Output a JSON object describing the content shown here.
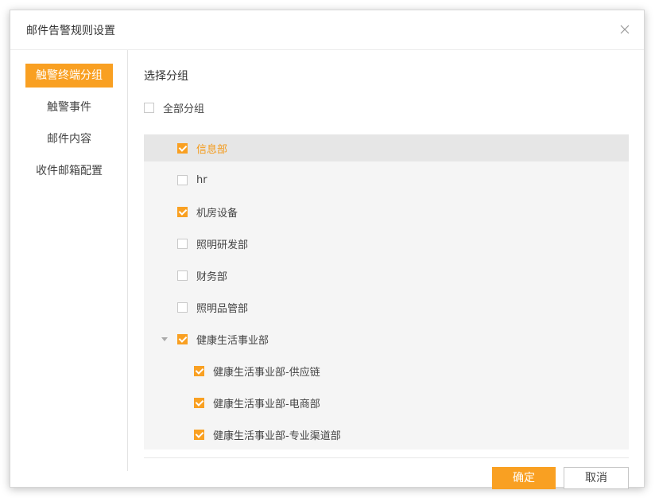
{
  "dialog": {
    "title": "邮件告警规则设置",
    "close_icon": "close-icon"
  },
  "sidebar": {
    "items": [
      {
        "label": "触警终端分组",
        "active": true
      },
      {
        "label": "触警事件",
        "active": false
      },
      {
        "label": "邮件内容",
        "active": false
      },
      {
        "label": "收件邮箱配置",
        "active": false
      }
    ]
  },
  "content": {
    "section_title": "选择分组",
    "select_all": {
      "label": "全部分组",
      "checked": false
    },
    "groups": [
      {
        "label": "信息部",
        "checked": true,
        "selected": true
      },
      {
        "label": "hr",
        "checked": false
      },
      {
        "label": "机房设备",
        "checked": true
      },
      {
        "label": "照明研发部",
        "checked": false
      },
      {
        "label": "财务部",
        "checked": false
      },
      {
        "label": "照明品管部",
        "checked": false
      },
      {
        "label": "健康生活事业部",
        "checked": true,
        "expanded": true
      },
      {
        "label": "健康生活事业部-供应链",
        "checked": true,
        "child": true
      },
      {
        "label": "健康生活事业部-电商部",
        "checked": true,
        "child": true
      },
      {
        "label": "健康生活事业部-专业渠道部",
        "checked": true,
        "child": true
      }
    ]
  },
  "footer": {
    "confirm_label": "确定",
    "cancel_label": "取消"
  },
  "colors": {
    "accent": "#f9a022"
  }
}
